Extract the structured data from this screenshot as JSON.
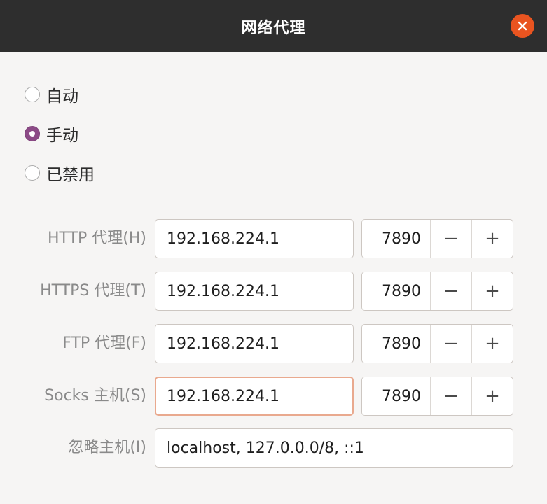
{
  "window": {
    "title": "网络代理",
    "close_icon": "close-icon",
    "accent_color": "#e95420"
  },
  "mode": {
    "options": [
      {
        "label": "自动",
        "selected": false
      },
      {
        "label": "手动",
        "selected": true
      },
      {
        "label": "已禁用",
        "selected": false
      }
    ],
    "selected_color": "#8c4a86"
  },
  "proxies": [
    {
      "label": "HTTP 代理(H)",
      "host": "192.168.224.1",
      "port": "7890"
    },
    {
      "label": "HTTPS 代理(T)",
      "host": "192.168.224.1",
      "port": "7890"
    },
    {
      "label": "FTP 代理(F)",
      "host": "192.168.224.1",
      "port": "7890"
    },
    {
      "label": "Socks 主机(S)",
      "host": "192.168.224.1",
      "port": "7890",
      "focused": true
    }
  ],
  "spin_buttons": {
    "decrement": "−",
    "increment": "+"
  },
  "ignore_hosts": {
    "label": "忽略主机(I)",
    "value": "localhost, 127.0.0.0/8, ::1"
  }
}
